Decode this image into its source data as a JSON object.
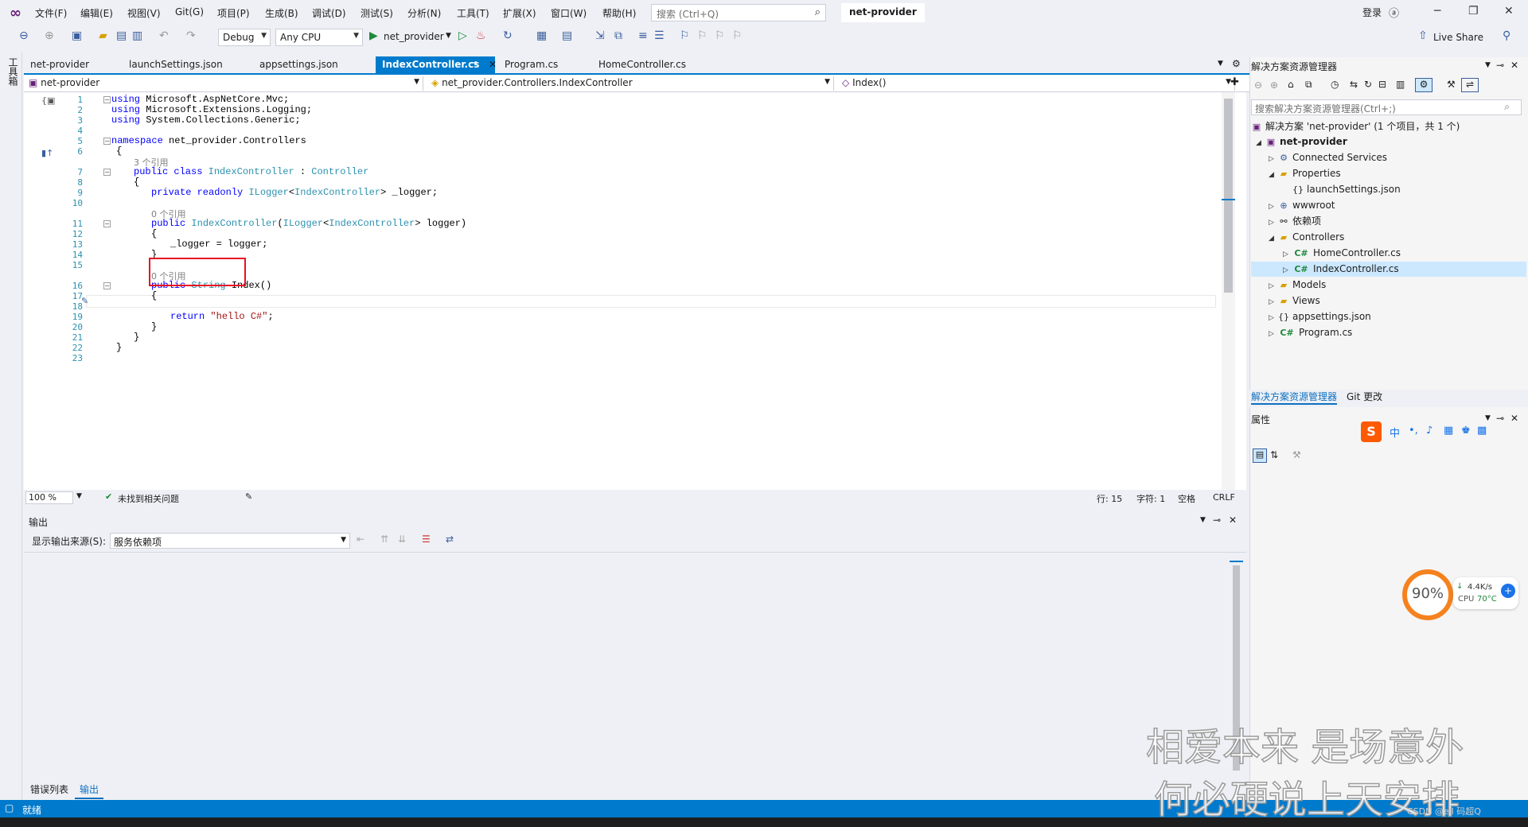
{
  "menu": {
    "items": [
      "文件(F)",
      "编辑(E)",
      "视图(V)",
      "Git(G)",
      "项目(P)",
      "生成(B)",
      "调试(D)",
      "测试(S)",
      "分析(N)",
      "工具(T)",
      "扩展(X)",
      "窗口(W)",
      "帮助(H)"
    ],
    "search_placeholder": "搜索 (Ctrl+Q)",
    "solution_title": "net-provider",
    "login": "登录"
  },
  "toolbar": {
    "config": "Debug",
    "platform": "Any CPU",
    "run_target": "net_provider",
    "live_share": "Live Share"
  },
  "left_strip": {
    "toolbox": "工具箱"
  },
  "doc_tabs": [
    {
      "label": "net-provider",
      "active": false
    },
    {
      "label": "launchSettings.json",
      "active": false
    },
    {
      "label": "appsettings.json",
      "active": false
    },
    {
      "label": "IndexController.cs",
      "active": true
    },
    {
      "label": "Program.cs",
      "active": false
    },
    {
      "label": "HomeController.cs",
      "active": false
    }
  ],
  "navbar": {
    "project": "net-provider",
    "class": "net_provider.Controllers.IndexController",
    "member": "Index()"
  },
  "code": {
    "line_numbers": [
      "1",
      "2",
      "3",
      "4",
      "5",
      "6",
      "7",
      "8",
      "9",
      "10",
      "11",
      "12",
      "13",
      "14",
      "15",
      "16",
      "17",
      "18",
      "19",
      "20",
      "21",
      "22",
      "23"
    ],
    "l1_kw": "using",
    "l1_rest": " Microsoft.AspNetCore.Mvc;",
    "l2_kw": "using",
    "l2_rest": " Microsoft.Extensions.Logging;",
    "l3_kw": "using",
    "l3_rest": " System.Collections.Generic;",
    "l5_kw": "namespace",
    "l5_rest": " net_provider.Controllers",
    "l6": "{",
    "ref7": "3 个引用",
    "l7_kw": "public class",
    "l7_type": "IndexController",
    "l7_sep": " : ",
    "l7_base": "Controller",
    "l8": "{",
    "l9_kw": "private readonly",
    "l9_type": "ILogger",
    "l9_lt": "<",
    "l9_gen": "IndexController",
    "l9_rest": "> _logger;",
    "ref11": "0 个引用",
    "l11_kw": "public",
    "l11_type": "IndexController",
    "l11_p": "(",
    "l11_ptype": "ILogger",
    "l11_lt": "<",
    "l11_gen": "IndexController",
    "l11_rest": "> logger)",
    "l12": "{",
    "l13": "_logger = logger;",
    "l14": "}",
    "ref16": "0 个引用",
    "l16_kw": "public",
    "l16_type": "String",
    "l16_rest": " Index()",
    "l17": "{",
    "l19_kw": "return",
    "l19_str": "\"hello C#\"",
    "l19_end": ";",
    "l20": "}",
    "l21": "}",
    "l22": "}"
  },
  "editor_status": {
    "zoom": "100 %",
    "issues": "未找到相关问题",
    "line": "行: 15",
    "col": "字符: 1",
    "spaces": "空格",
    "eol": "CRLF"
  },
  "output": {
    "title": "输出",
    "source_label": "显示输出来源(S):",
    "source_value": "服务依赖项",
    "tabs": [
      "错误列表",
      "输出"
    ]
  },
  "status": {
    "ready": "就绪"
  },
  "solution_explorer": {
    "title": "解决方案资源管理器",
    "search_placeholder": "搜索解决方案资源管理器(Ctrl+;)",
    "solution": "解决方案 'net-provider' (1 个项目，共 1 个)",
    "project": "net-provider",
    "items": {
      "connected": "Connected Services",
      "properties": "Properties",
      "launch": "launchSettings.json",
      "wwwroot": "wwwroot",
      "deps": "依赖项",
      "controllers": "Controllers",
      "home": "HomeController.cs",
      "index": "IndexController.cs",
      "models": "Models",
      "views": "Views",
      "appsettings": "appsettings.json",
      "program": "Program.cs"
    },
    "tabs": [
      "解决方案资源管理器",
      "Git 更改"
    ]
  },
  "properties": {
    "title": "属性"
  },
  "cpu_widget": {
    "percent": "90%",
    "speed": "4.4K/s",
    "cpu_label": "CPU",
    "temp": "70°C"
  },
  "watermark": {
    "line1": "相爱本来 是场意外",
    "line2": "何必硬说上天安排",
    "credit": "CSDN @ell 码超Q"
  },
  "colors": {
    "accent": "#007acc",
    "keyword": "#0000ff",
    "type": "#2b91af",
    "string": "#a31515",
    "highlight_box": "#e81123",
    "cpu_ring": "#f5821f"
  }
}
